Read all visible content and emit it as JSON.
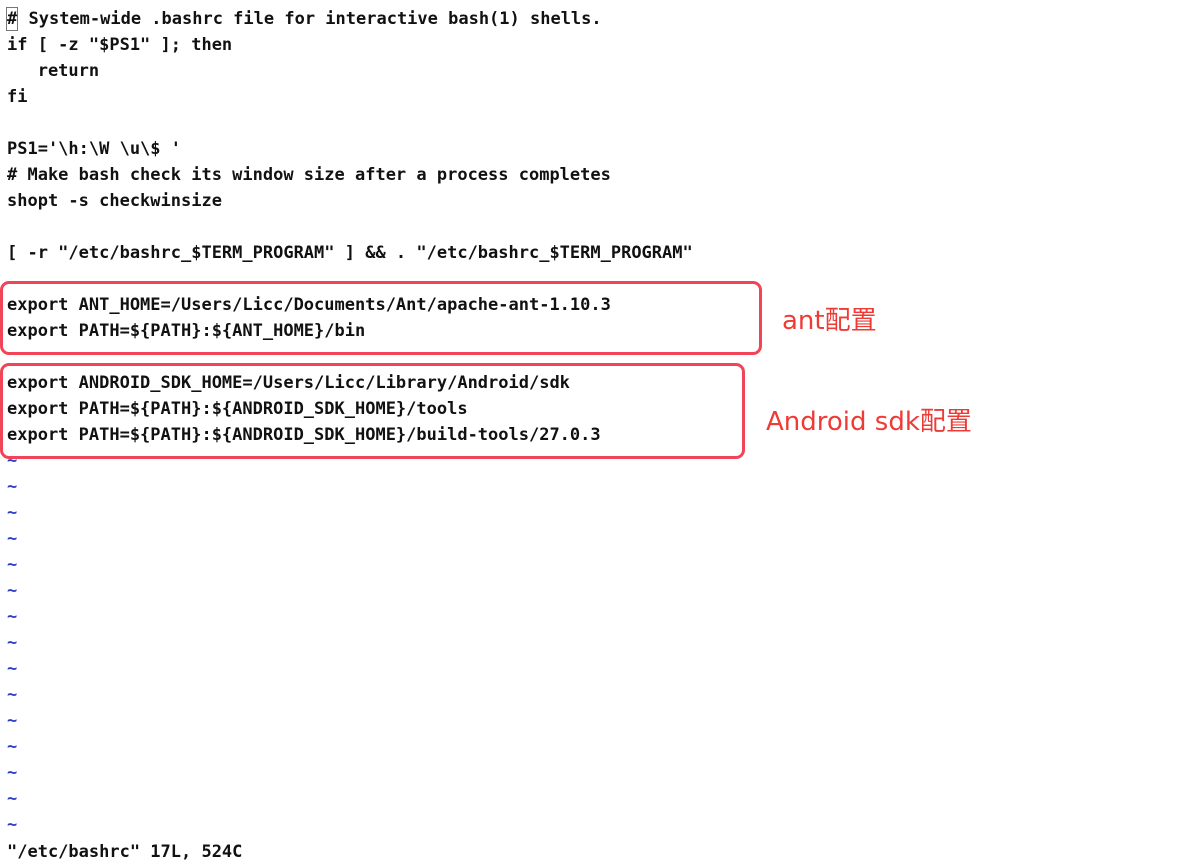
{
  "editor": {
    "lines": [
      {
        "cursor_char": "#",
        "text": " System-wide .bashrc file for interactive bash(1) shells."
      },
      {
        "text": "if [ -z \"$PS1\" ]; then"
      },
      {
        "text": "   return"
      },
      {
        "text": "fi"
      },
      {
        "text": ""
      },
      {
        "text": "PS1='\\h:\\W \\u\\$ '"
      },
      {
        "text": "# Make bash check its window size after a process completes"
      },
      {
        "text": "shopt -s checkwinsize"
      },
      {
        "text": ""
      },
      {
        "text": "[ -r \"/etc/bashrc_$TERM_PROGRAM\" ] && . \"/etc/bashrc_$TERM_PROGRAM\""
      },
      {
        "text": ""
      },
      {
        "text": "export ANT_HOME=/Users/Licc/Documents/Ant/apache-ant-1.10.3"
      },
      {
        "text": "export PATH=${PATH}:${ANT_HOME}/bin"
      },
      {
        "text": ""
      },
      {
        "text": "export ANDROID_SDK_HOME=/Users/Licc/Library/Android/sdk"
      },
      {
        "text": "export PATH=${PATH}:${ANDROID_SDK_HOME}/tools"
      },
      {
        "text": "export PATH=${PATH}:${ANDROID_SDK_HOME}/build-tools/27.0.3"
      }
    ],
    "empty_line_marker": "~",
    "empty_line_count": 15
  },
  "status_line": "\"/etc/bashrc\" 17L, 524C",
  "annotations": [
    {
      "label": "ant配置",
      "color": "#ef3b36"
    },
    {
      "label": "Android sdk配置",
      "color": "#ef3b36"
    }
  ],
  "colors": {
    "tilde": "#2b3cc4",
    "highlight_border": "#f24459",
    "text": "#111111",
    "background": "#ffffff"
  }
}
